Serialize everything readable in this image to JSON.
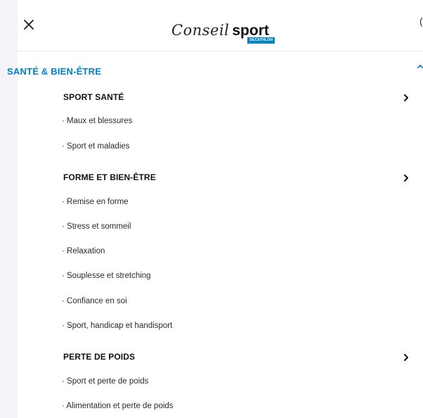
{
  "header": {
    "logo_script": "Conseil",
    "logo_bold": "sport",
    "logo_badge": "DECATHLON"
  },
  "menu": {
    "section_title": "SANTÉ & BIEN-ÊTRE",
    "categories": [
      {
        "label": "SPORT SANTÉ",
        "items": [
          "· Maux et blessures",
          "· Sport et maladies"
        ]
      },
      {
        "label": "FORME ET BIEN-ÊTRE",
        "items": [
          "· Remise en forme",
          "· Stress et sommeil",
          "· Relaxation",
          "· Souplesse et stretching",
          "· Confiance en soi",
          "· Sport, handicap et handisport"
        ]
      },
      {
        "label": "PERTE DE POIDS",
        "items": [
          "· Sport et perte de poids",
          "· Alimentation et perte de poids"
        ]
      }
    ]
  },
  "colors": {
    "accent": "#0082c3",
    "rail": "#f3f3f8",
    "text": "#1a1a1a"
  },
  "icons": {
    "close": "close-icon",
    "chevron": "chevron-right-icon",
    "section": "chevron-up-icon"
  }
}
